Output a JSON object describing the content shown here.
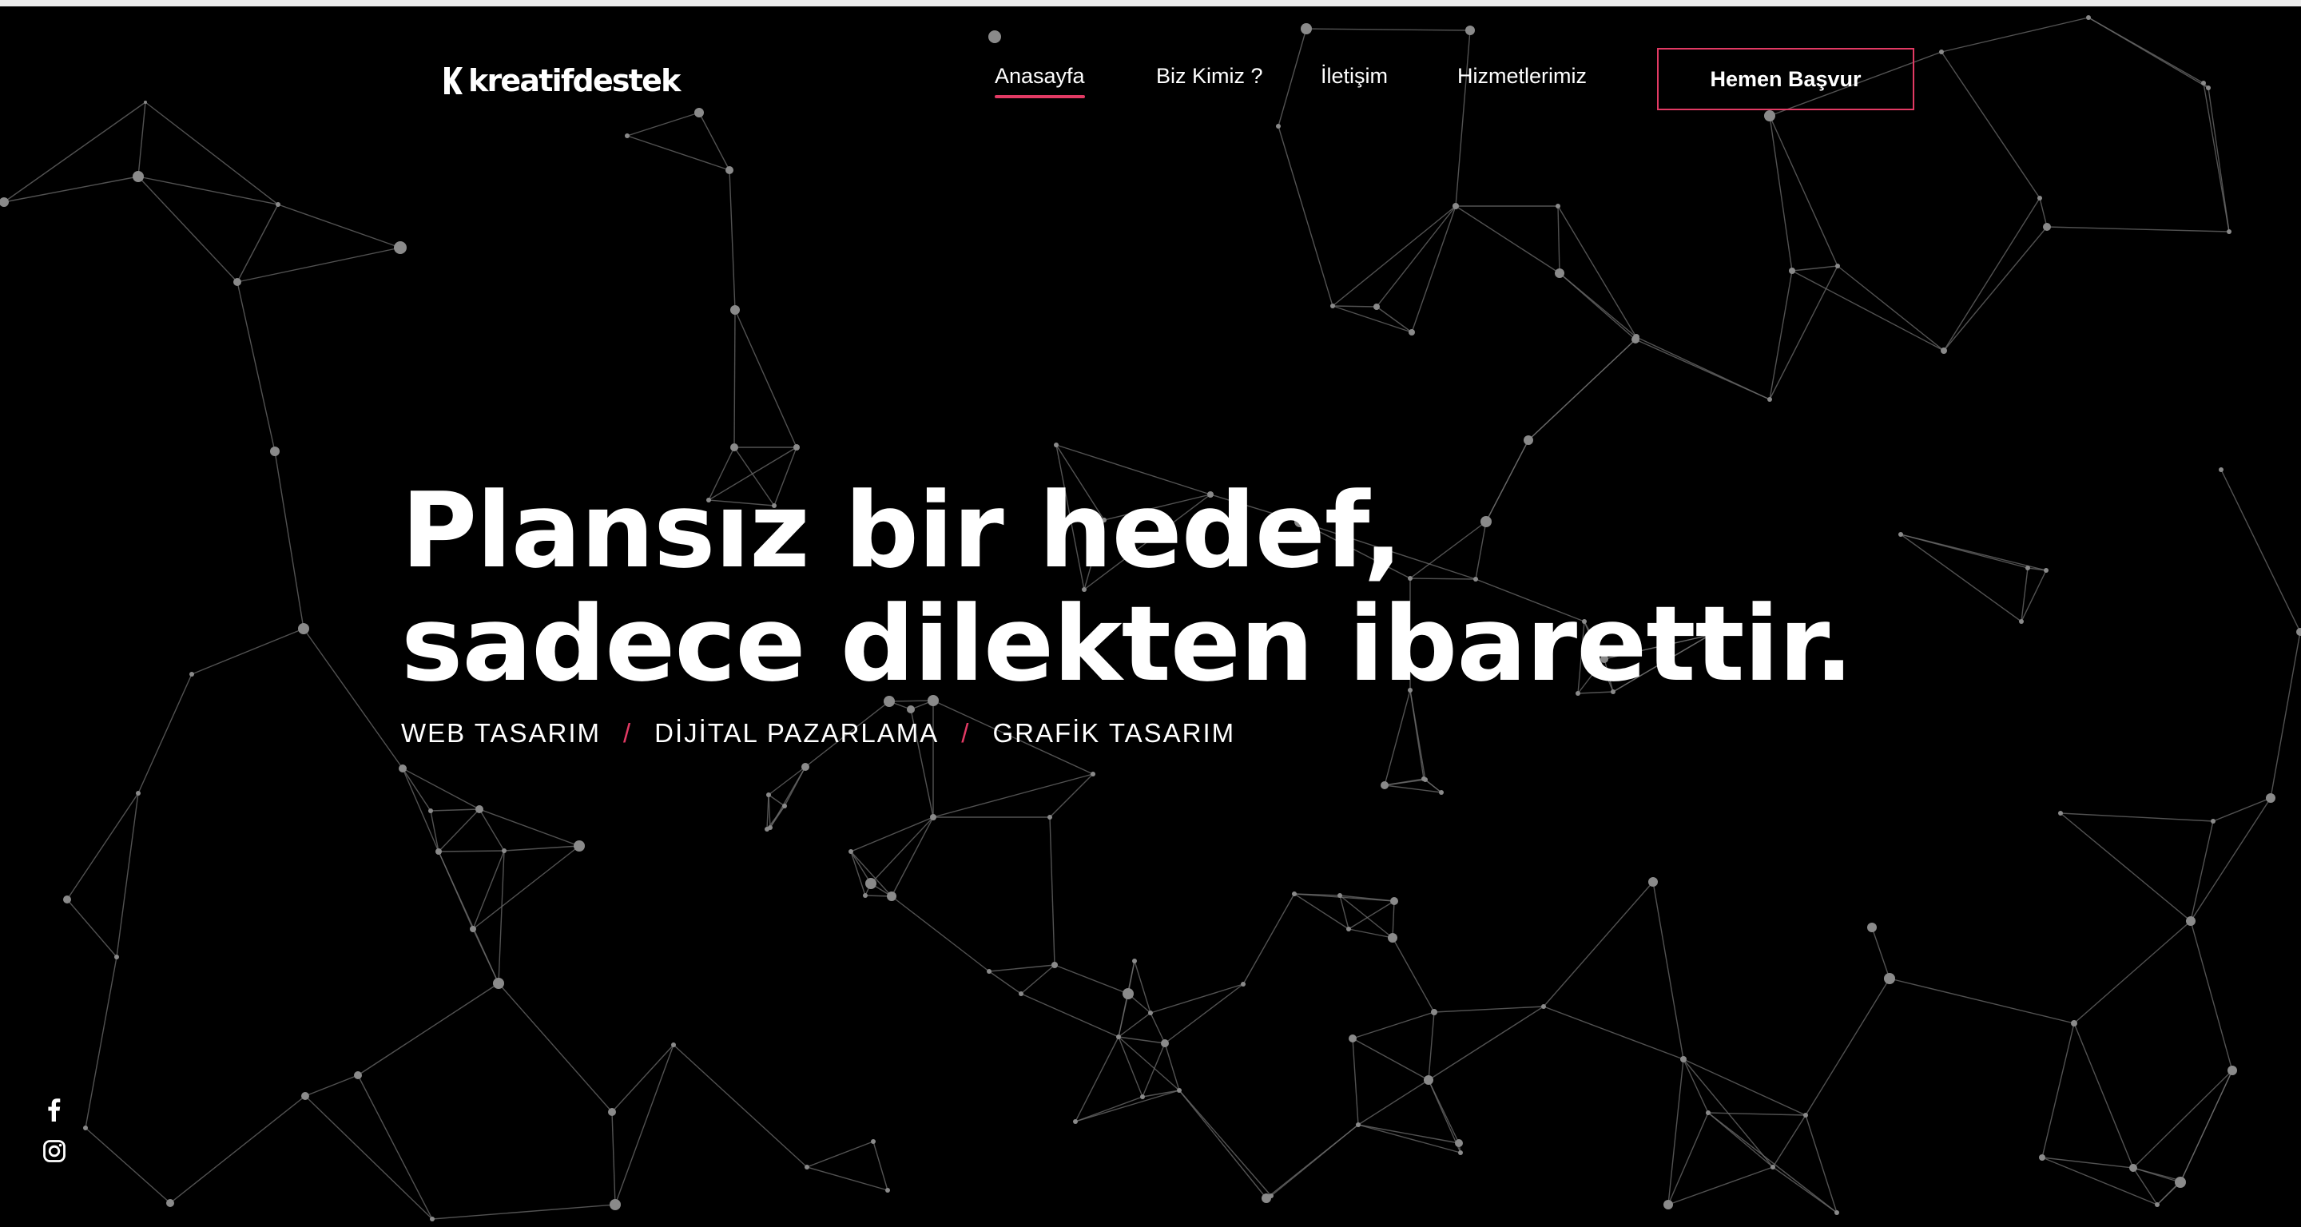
{
  "brand": {
    "name": "kreatifdestek",
    "accent_color": "#e23a64",
    "logo_icon": "k-logo-icon"
  },
  "nav": {
    "items": [
      {
        "label": "Anasayfa",
        "active": true
      },
      {
        "label": "Biz Kimiz ?",
        "active": false
      },
      {
        "label": "İletişim",
        "active": false
      },
      {
        "label": "Hizmetlerimiz",
        "active": false
      }
    ],
    "cta_label": "Hemen Başvur"
  },
  "hero": {
    "title_line1": "Plansız bir hedef,",
    "title_line2": "sadece dilekten ibarettir.",
    "services": [
      "WEB TASARIM",
      "DİJİTAL PAZARLAMA",
      "GRAFİK TASARIM"
    ],
    "separator": "/"
  },
  "social": {
    "icons": [
      "facebook-icon",
      "instagram-icon"
    ]
  },
  "background": {
    "color": "#000000",
    "pattern": "particle-network"
  }
}
